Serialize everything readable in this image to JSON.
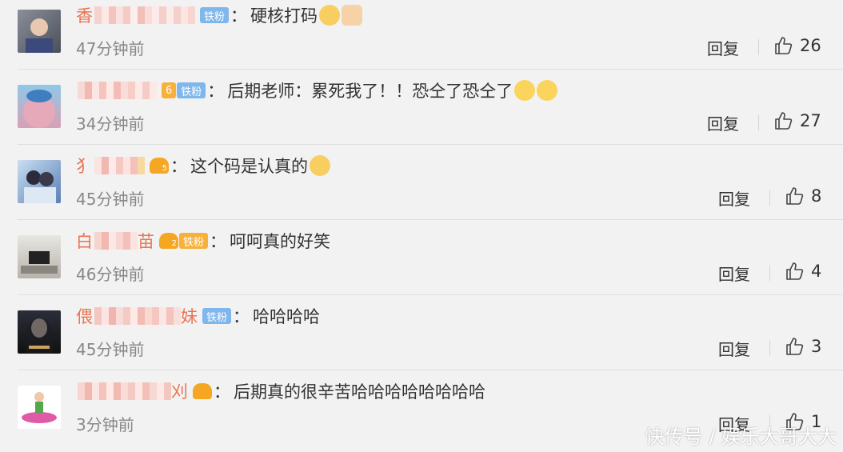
{
  "comments": [
    {
      "username_visible": "香",
      "badges": [
        "铁粉"
      ],
      "text": "硬核打码",
      "emoji": [
        "doge-emoji",
        "thumbs-up-emoji"
      ],
      "time": "47分钟前",
      "reply": "回复",
      "likes": "26"
    },
    {
      "username_visible": "",
      "badges": [
        "6",
        "铁粉"
      ],
      "text": "后期老师：累死我了！！恐仝了恐仝了",
      "emoji": [
        "cry-emoji",
        "cry-emoji"
      ],
      "time": "34分钟前",
      "reply": "回复",
      "likes": "27"
    },
    {
      "username_visible": "犭",
      "badges": [
        "5"
      ],
      "text": "这个码是认真的",
      "emoji": [
        "doge-emoji"
      ],
      "time": "45分钟前",
      "reply": "回复",
      "likes": "8"
    },
    {
      "username_visible": "白",
      "username_suffix": "苗",
      "badges": [
        "2",
        "铁粉"
      ],
      "text": "呵呵真的好笑",
      "emoji": [],
      "time": "46分钟前",
      "reply": "回复",
      "likes": "4"
    },
    {
      "username_visible": "偎",
      "username_suffix": "妹",
      "badges": [
        "铁粉"
      ],
      "text": "哈哈哈哈",
      "emoji": [],
      "time": "45分钟前",
      "reply": "回复",
      "likes": "3"
    },
    {
      "username_visible": "",
      "username_suffix": "刈",
      "badges": [
        "crown"
      ],
      "text": "后期真的很辛苦哈哈哈哈哈哈哈哈",
      "emoji": [],
      "time": "3分钟前",
      "reply": "回复",
      "likes": "1"
    }
  ],
  "watermark": "快传号 / 娱乐大哥大大",
  "colors": {
    "username": "#eb7350",
    "badge_tie": "#7fb6ec",
    "crown": "#f5a623",
    "background": "#f2f2f2"
  }
}
